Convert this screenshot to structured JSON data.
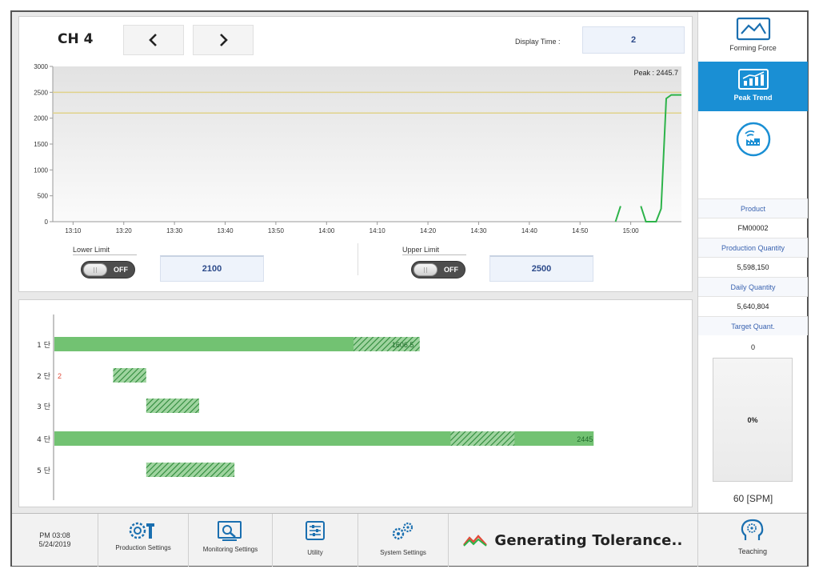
{
  "header": {
    "channel": "CH 4",
    "display_time_label": "Display Time :",
    "display_time_value": "2"
  },
  "limits": {
    "lower_label": "Lower Limit",
    "lower_toggle": "OFF",
    "lower_value": "2100",
    "upper_label": "Upper Limit",
    "upper_toggle": "OFF",
    "upper_value": "2500"
  },
  "chart_data": [
    {
      "type": "line",
      "annotation": "Peak : 2445.7",
      "x_ticks": [
        "13:10",
        "13:20",
        "13:30",
        "13:40",
        "13:50",
        "14:00",
        "14:10",
        "14:20",
        "14:30",
        "14:40",
        "14:50",
        "15:00"
      ],
      "y_ticks": [
        0,
        500,
        1000,
        1500,
        2000,
        2500,
        3000
      ],
      "ylim": [
        0,
        3000
      ],
      "grid": false,
      "reference_lines": [
        2500,
        2100
      ],
      "series": [
        {
          "color": "#2db34a",
          "points": [
            [
              "14:57",
              0
            ],
            [
              "14:58",
              300
            ],
            [
              "15:02",
              300
            ],
            [
              "15:03",
              0
            ],
            [
              "15:05",
              0
            ],
            [
              "15:06",
              250
            ],
            [
              "15:07",
              2380
            ],
            [
              "15:08",
              2450
            ],
            [
              "15:10",
              2450
            ]
          ]
        }
      ]
    },
    {
      "type": "bar",
      "orientation": "horizontal",
      "categories": [
        "1 단",
        "2 단",
        "3 단",
        "4 단",
        "5 단"
      ],
      "series": [
        {
          "kind": "current",
          "values": [
            1606,
            0,
            0,
            2445,
            0
          ],
          "color": "#72c272"
        },
        {
          "kind": "tolerance",
          "ranges": [
            [
              1360,
              1660
            ],
            [
              270,
              420
            ],
            [
              420,
              660
            ],
            [
              1800,
              2090
            ],
            [
              420,
              820
            ]
          ],
          "color": "#2e8a3a"
        }
      ],
      "data_labels": [
        "1606.5",
        "2",
        "",
        "2445",
        ""
      ],
      "xlim": [
        0,
        2600
      ]
    }
  ],
  "sidebar": {
    "btn_forming": "Forming Force",
    "btn_peak": "Peak Trend",
    "product_label": "Product",
    "product_value": "FM00002",
    "prod_qty_label": "Production Quantity",
    "prod_qty_value": "5,598,150",
    "daily_qty_label": "Daily Quantity",
    "daily_qty_value": "5,640,804",
    "target_label": "Target Quant.",
    "target_value": "0",
    "progress_text": "0%",
    "progress_fraction": 0,
    "spm": "60 [SPM]"
  },
  "bottombar": {
    "time": "PM 03:08",
    "date": "5/24/2019",
    "btn_production": "Production Settings",
    "btn_monitoring": "Monitoring Settings",
    "btn_utility": "Utility",
    "btn_system": "System Settings",
    "status_text": "Generating Tolerance..",
    "btn_teaching": "Teaching"
  },
  "colors": {
    "accent": "#1a8fd4",
    "line_green": "#2db34a",
    "limit_line": "#e0d28a",
    "bar_green": "#72c272",
    "tolerance_green": "#2e8a3a",
    "value_red": "#e04b3a"
  }
}
